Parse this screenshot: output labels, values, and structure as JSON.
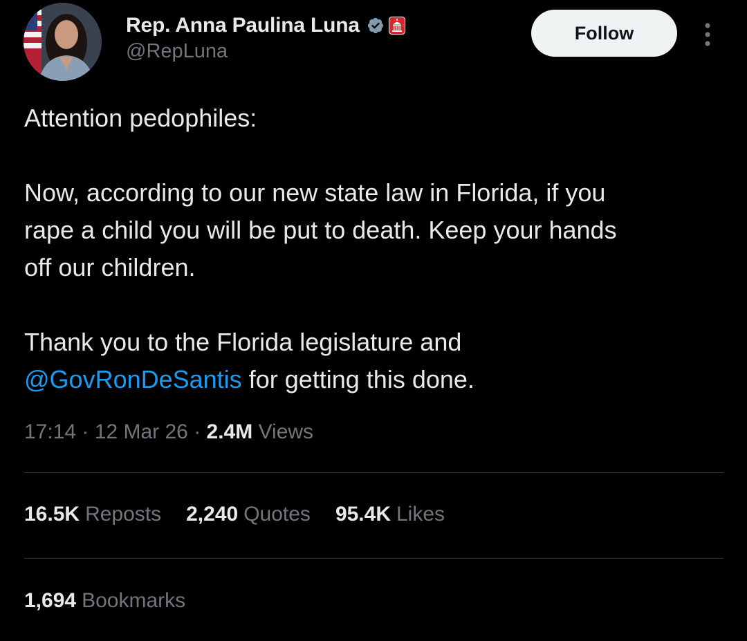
{
  "author": {
    "display_name": "Rep. Anna Paulina Luna",
    "handle": "@RepLuna",
    "verified_icon": "verified-badge-icon",
    "affiliate_icon": "us-capitol-affiliate-icon"
  },
  "follow_label": "Follow",
  "more_icon": "more-vertical-icon",
  "tweet": {
    "line1": "Attention pedophiles:",
    "line2": "Now, according to our new state law in Florida, if you",
    "line3": "rape a child you will be put to death. Keep your hands",
    "line4": "off our children.",
    "line5": "Thank you to the Florida legislature and",
    "mention": "@GovRonDeSantis",
    "line6_rest": " for getting this done."
  },
  "meta": {
    "time": "17:14",
    "separator": "·",
    "date": "12 Mar 26",
    "views_count": "2.4M",
    "views_label": "Views"
  },
  "stats": {
    "reposts_count": "16.5K",
    "reposts_label": "Reposts",
    "quotes_count": "2,240",
    "quotes_label": "Quotes",
    "likes_count": "95.4K",
    "likes_label": "Likes",
    "bookmarks_count": "1,694",
    "bookmarks_label": "Bookmarks"
  },
  "colors": {
    "background": "#000000",
    "text": "#e7e9ea",
    "secondary": "#71767b",
    "link": "#1d9bf0",
    "verified_badge": "#829aab",
    "affiliate_red": "#d4282e",
    "divider": "#2f3336"
  }
}
